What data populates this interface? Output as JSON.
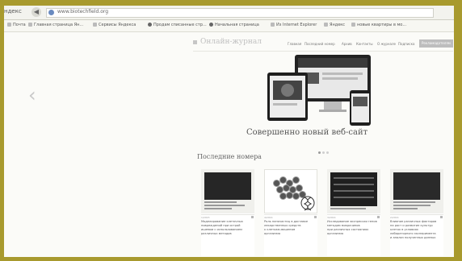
{
  "browser": {
    "app_label": "ндекс",
    "back_icon": "back-arrow-icon",
    "address": "www.biotechfield.org",
    "bookmarks": [
      "Почта",
      "Главная страница Ян...",
      "Сервисы Яндекса",
      "Продам списанные стр...",
      "Начальная страница",
      "Из Internet Explorer",
      "Яндекс",
      "новые квартиры в мо..."
    ]
  },
  "site": {
    "logo": "Онлайн-журнал",
    "menu": [
      "Главная",
      "Последний номер",
      "Архив",
      "Контакты",
      "О журнале",
      "Подписка",
      "Рекламодателям"
    ],
    "active_menu_index": 6,
    "hero_caption": "Совершенно новый веб-сайт",
    "slider_dots": 3,
    "active_dot": 0,
    "section_title": "Последние номера",
    "issues": [
      {
        "date": "1/2015",
        "description": "Моделирование клеточных\nповреждений при острой\nишемии с использованием\nразличных методов"
      },
      {
        "date": "4/2014",
        "description": "Роль наночастиц в доставке\nлекарственных средств\nк клеткам-мишеням\nорганизма"
      },
      {
        "date": "3/2014",
        "description": "Исследование экспрессии генов\nметодом микрочипов\nпри различных состояниях\nорганизма"
      },
      {
        "date": "2/2014",
        "description": "Влияние различных факторов\nна рост и развитие культур\nклеток в условиях\nлабораторного эксперимента\nи анализ полученных данных"
      }
    ]
  }
}
